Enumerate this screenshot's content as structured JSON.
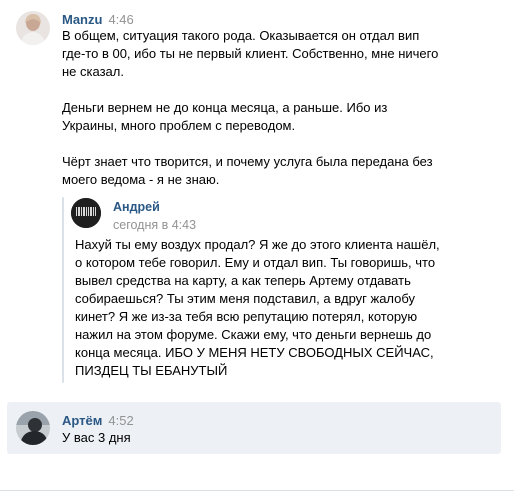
{
  "messages": [
    {
      "author": "Manzu",
      "time": "4:46",
      "text": "В общем, ситуация такого рода. Оказывается он отдал вип\nгде-то в 00, ибо ты не первый клиент. Собственно, мне ничего\nне сказал.\n\nДеньги вернем не до конца месяца, а раньше. Ибо из\nУкраины, много проблем с переводом.\n\nЧёрт знает что творится, и почему услуга была передана без\nмоего ведома - я не знаю.",
      "forwarded": {
        "author": "Андрей",
        "time": "сегодня в 4:43",
        "text": "Нахуй ты ему воздух продал? Я же до этого клиента нашёл,\nо котором тебе говорил. Ему и отдал вип. Ты говоришь, что\nвывел средства на карту, а как теперь Артему отдавать\nсобираешься? Ты этим меня подставил, а вдруг жалобу\nкинет? Я же из-за тебя всю репутацию потерял, которую\nнажил на этом форуме. Скажи ему, что деньги вернешь до\nконца месяца. ИБО У МЕНЯ НЕТУ СВОБОДНЫХ СЕЙЧАС,\nПИЗДЕЦ ТЫ ЕБАНУТЫЙ",
        "avatar_text": "PROJECT"
      }
    },
    {
      "author": "Артём",
      "time": "4:52",
      "text": "У вас 3 дня",
      "highlighted": true
    }
  ],
  "colors": {
    "author": "#2a5885",
    "time": "#939393",
    "highlight_bg": "#edf0f5",
    "quote_bar": "#dae1e8"
  }
}
